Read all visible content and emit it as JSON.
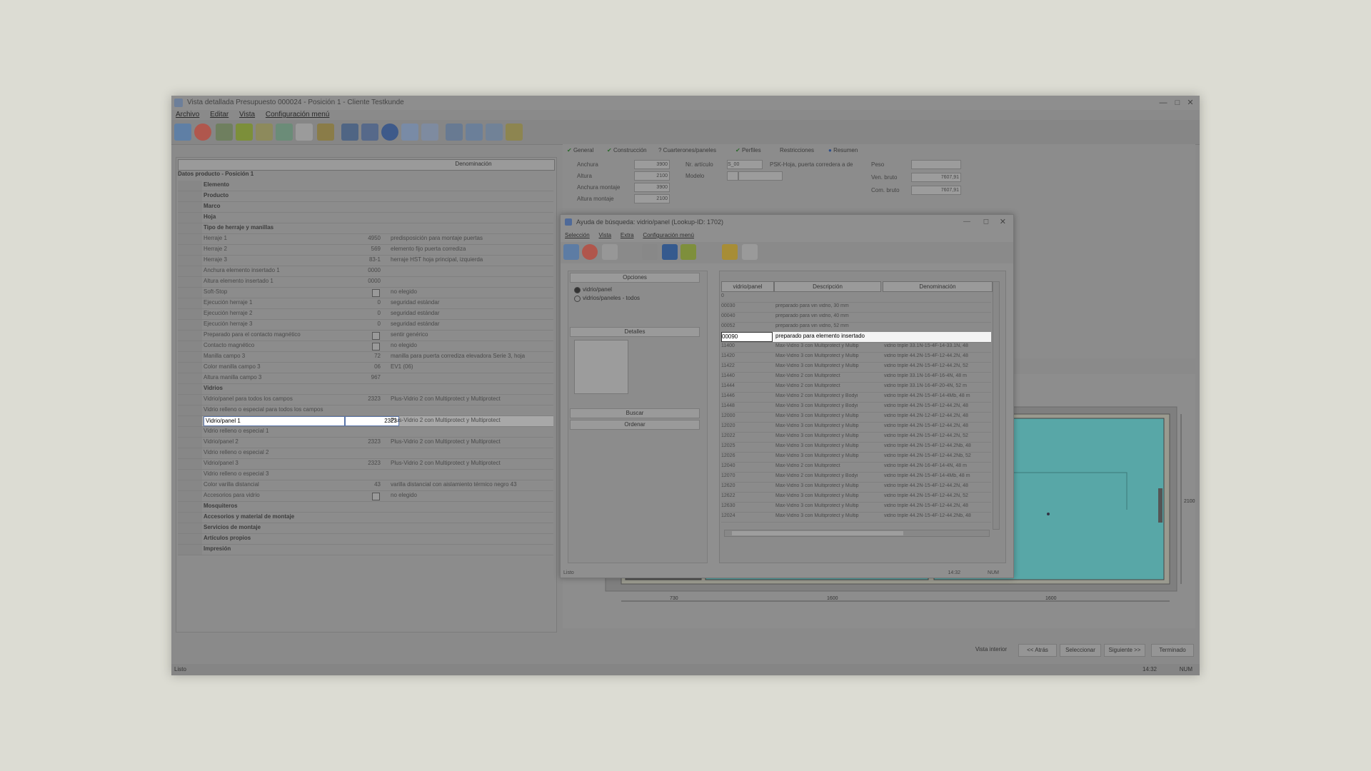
{
  "main": {
    "title": "Vista detallada Presupuesto 000024 - Posición 1 - Cliente Testkunde",
    "menu": [
      "Archivo",
      "Editar",
      "Vista",
      "Configuración menú"
    ],
    "left_grid_header": "Denominación",
    "section_title": "Datos producto - Posición 1",
    "rows": [
      {
        "label": "Elemento",
        "value": "",
        "desc": "",
        "group": true
      },
      {
        "label": "Producto",
        "value": "",
        "desc": "",
        "group": true
      },
      {
        "label": "Marco",
        "value": "",
        "desc": "",
        "group": true
      },
      {
        "label": "Hoja",
        "value": "",
        "desc": "",
        "group": true
      },
      {
        "label": "Tipo de herraje y manillas",
        "value": "",
        "desc": "",
        "group": true
      },
      {
        "label": "Herraje 1",
        "value": "4950",
        "desc": "predisposición para montaje puertas"
      },
      {
        "label": "Herraje 2",
        "value": "569",
        "desc": "elemento fijo puerta corrediza"
      },
      {
        "label": "Herraje 3",
        "value": "83-1",
        "desc": "herraje HST hoja principal, izquierda"
      },
      {
        "label": "Anchura elemento insertado 1",
        "value": "0000",
        "desc": ""
      },
      {
        "label": "Altura elemento insertado 1",
        "value": "0000",
        "desc": ""
      },
      {
        "label": "Soft-Stop",
        "value": "",
        "desc": "no elegido",
        "check": true
      },
      {
        "label": "Ejecución herraje 1",
        "value": "0",
        "desc": "seguridad estándar"
      },
      {
        "label": "Ejecución herraje 2",
        "value": "0",
        "desc": "seguridad estándar"
      },
      {
        "label": "Ejecución herraje 3",
        "value": "0",
        "desc": "seguridad estándar"
      },
      {
        "label": "Preparado para el contacto magnético",
        "value": "",
        "desc": "sentir genérico",
        "check": true
      },
      {
        "label": "Contacto magnético",
        "value": "",
        "desc": "no elegido",
        "check": true
      },
      {
        "label": "Manilla campo 3",
        "value": "72",
        "desc": "manilla para puerta corrediza elevadora Serie 3, hoja"
      },
      {
        "label": "Color manilla campo 3",
        "value": "06",
        "desc": "EV1 (06)"
      },
      {
        "label": "Altura manilla campo 3",
        "value": "967",
        "desc": ""
      },
      {
        "label": "Vidrios",
        "value": "",
        "desc": "",
        "group": true
      },
      {
        "label": "Vidrio/panel para todos los campos",
        "value": "2323",
        "desc": "Plus-Vidrio 2 con Multiprotect y Multiprotect"
      },
      {
        "label": "Vidrio relleno o especial para todos los campos",
        "value": "",
        "desc": ""
      },
      {
        "label": "Vidrio/panel 1",
        "value": "2323",
        "desc": "Plus-Vidrio 2 con Multiprotect y Multiprotect",
        "selected": true
      },
      {
        "label": "Vidrio relleno o especial 1",
        "value": "",
        "desc": ""
      },
      {
        "label": "Vidrio/panel 2",
        "value": "2323",
        "desc": "Plus-Vidrio 2 con Multiprotect y Multiprotect"
      },
      {
        "label": "Vidrio relleno o especial 2",
        "value": "",
        "desc": ""
      },
      {
        "label": "Vidrio/panel 3",
        "value": "2323",
        "desc": "Plus-Vidrio 2 con Multiprotect y Multiprotect"
      },
      {
        "label": "Vidrio relleno o especial 3",
        "value": "",
        "desc": ""
      },
      {
        "label": "Color varilla distancial",
        "value": "43",
        "desc": "varilla distancial con aislamiento térmico negro 43"
      },
      {
        "label": "Accesorios para vidrio",
        "value": "",
        "desc": "no elegido",
        "check": true
      },
      {
        "label": "Mosquiteros",
        "value": "",
        "desc": "",
        "group": true
      },
      {
        "label": "Accesorios y material de montaje",
        "value": "",
        "desc": "",
        "group": true
      },
      {
        "label": "Servicios de montaje",
        "value": "",
        "desc": "",
        "group": true
      },
      {
        "label": "Artículos propios",
        "value": "",
        "desc": "",
        "group": true
      },
      {
        "label": "Impresión",
        "value": "",
        "desc": "",
        "group": true
      }
    ],
    "tabs": [
      "General",
      "Construcción",
      "Cuarterones/paneles",
      "Perfiles",
      "Restricciones",
      "Resumen"
    ],
    "form": {
      "anchura_lbl": "Anchura",
      "anchura_val": "3900",
      "altura_lbl": "Altura",
      "altura_val": "2100",
      "anchura_montaje_lbl": "Anchura montaje",
      "anchura_montaje_val": "3900",
      "altura_montaje_lbl": "Altura montaje",
      "altura_montaje_val": "2100",
      "articulo_lbl": "Nr. artículo",
      "articulo_val": "S_00",
      "articulo_desc": "PSK-Hoja, puerta corredera a de",
      "modelo_lbl": "Modelo",
      "peso_lbl": "Peso",
      "ven_bruto_lbl": "Ven. bruto",
      "ven_bruto_val": "7607,91",
      "com_bruto_lbl": "Com. bruto",
      "com_bruto_val": "7607,91"
    },
    "dims": {
      "d1": "730",
      "d2": "1600",
      "d3": "1600",
      "h": "2100"
    },
    "bottom_buttons": [
      "Vista interior",
      "<< Atrás",
      "Seleccionar",
      "Siguiente >>",
      "Terminado"
    ],
    "status_left": "Listo",
    "status_r1": "14:32",
    "status_r2": "NUM"
  },
  "dialog": {
    "title": "Ayuda de búsqueda: vidrio/panel (Lookup-ID: 1702)",
    "menu": [
      "Selección",
      "Vista",
      "Extra",
      "Configuración menú"
    ],
    "opciones_label": "Opciones",
    "radio1": "vidrio/panel",
    "radio2": "vidrios/paneles - todos",
    "detalles_label": "Detalles",
    "buscar_label": "Buscar",
    "ordenar_label": "Ordenar",
    "columns": [
      "vidrio/panel",
      "Descripción",
      "Denominación"
    ],
    "rows": [
      {
        "a": "0",
        "b": "",
        "c": ""
      },
      {
        "a": "00030",
        "b": "preparado para vin vidrio, 30 mm",
        "c": ""
      },
      {
        "a": "00040",
        "b": "preparado para vin vidrio, 40 mm",
        "c": ""
      },
      {
        "a": "00052",
        "b": "preparado para vin vidrio, 52 mm",
        "c": ""
      },
      {
        "a": "00090",
        "b": "preparado para elemento insertado",
        "c": "",
        "highlight": true
      },
      {
        "a": "11400",
        "b": "Max-Vidrio 3 con Multiprotect y Multip",
        "c": "vidrio triple 33.1N-15-4F-14-33.1N, 48"
      },
      {
        "a": "11420",
        "b": "Max-Vidrio 3 con Multiprotect y Multip",
        "c": "vidrio triple 44.2N-15-4F-12-44.2N, 48"
      },
      {
        "a": "11422",
        "b": "Max-Vidrio 3 con Multiprotect y Multip",
        "c": "vidrio triple 44.2N-15-4F-12-44.2N, 52"
      },
      {
        "a": "11440",
        "b": "Max-Vidrio 2 con Multiprotect",
        "c": "vidrio triple 33.1N-16-4F-16-4N, 48 m"
      },
      {
        "a": "11444",
        "b": "Max-Vidrio 2 con Multiprotect",
        "c": "vidrio triple 33.1N-16-4F-20-4N, 52 m"
      },
      {
        "a": "11446",
        "b": "Max-Vidrio 2 con Multiprotect y Bodyi",
        "c": "vidrio triple 44.2N-15-4F-14-4Mb, 48 m"
      },
      {
        "a": "11448",
        "b": "Max-Vidrio 3 con Multiprotect y Bodyi",
        "c": "vidrio triple 44.2N-15-4F-12-44.2N, 48"
      },
      {
        "a": "12000",
        "b": "Max-Vidrio 3 con Multiprotect y Multip",
        "c": "vidrio triple 44.2N-12-4F-12-44.2N, 48"
      },
      {
        "a": "12020",
        "b": "Max-Vidrio 3 con Multiprotect y Multip",
        "c": "vidrio triple 44.2N-15-4F-12-44.2N, 48"
      },
      {
        "a": "12022",
        "b": "Max-Vidrio 3 con Multiprotect y Multip",
        "c": "vidrio triple 44.2N-15-4F-12-44.2N, 52"
      },
      {
        "a": "12025",
        "b": "Max-Vidrio 3 con Multiprotect y Multip",
        "c": "vidrio triple 44.2N-15-4F-12-44.2Nb, 48"
      },
      {
        "a": "12026",
        "b": "Max-Vidrio 3 con Multiprotect y Multip",
        "c": "vidrio triple 44.2N-15-4F-12-44.2Nb, 52"
      },
      {
        "a": "12040",
        "b": "Max-Vidrio 2 con Multiprotect",
        "c": "vidrio triple 44.2N-16-4F-14-4N, 48 m"
      },
      {
        "a": "12070",
        "b": "Max-Vidrio 2 con Multiprotect y Bodyi",
        "c": "vidrio triple 44.2N-15-4F-14-4Mb, 48 m"
      },
      {
        "a": "12620",
        "b": "Max-Vidrio 3 con Multiprotect y Multip",
        "c": "vidrio triple 44.2N-15-4F-12-44.2N, 48"
      },
      {
        "a": "12622",
        "b": "Max-Vidrio 3 con Multiprotect y Multip",
        "c": "vidrio triple 44.2N-15-4F-12-44.2N, 52"
      },
      {
        "a": "12630",
        "b": "Max-Vidrio 3 con Multiprotect y Multip",
        "c": "vidrio triple 44.2N-15-4F-12-44.2N, 48"
      },
      {
        "a": "12024",
        "b": "Max-Vidrio 3 con Multiprotect y Multip",
        "c": "vidrio triple 44.2N-15-4F-12-44.2Nb, 48"
      }
    ],
    "status_left": "Listo",
    "status_r1": "14:32",
    "status_r2": "NUM"
  }
}
